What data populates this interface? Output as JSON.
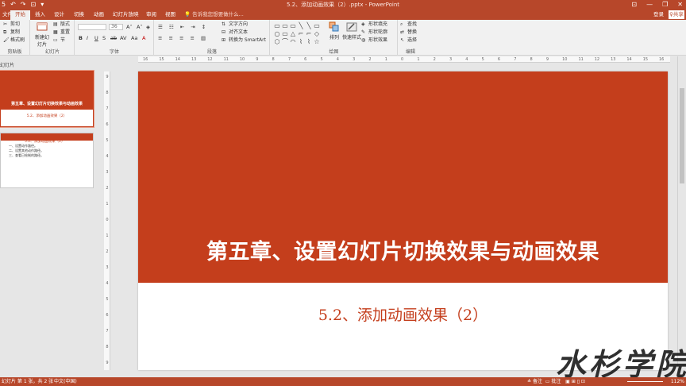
{
  "window": {
    "title": "5.2、添加动画效果（2）.pptx - PowerPoint",
    "qat": [
      "5",
      "↶",
      "↷",
      "⊡",
      "▾"
    ],
    "controls": [
      "⊡",
      "—",
      "❐",
      "✕"
    ]
  },
  "tabs": [
    "文件",
    "开始",
    "插入",
    "设计",
    "切换",
    "动画",
    "幻灯片放映",
    "审阅",
    "视图"
  ],
  "tell_me": "告诉我您想要做什么...",
  "account": {
    "login": "登录",
    "share": "共享"
  },
  "ribbon": {
    "clipboard": {
      "cut": "剪切",
      "copy": "复制",
      "format_painter": "格式刷",
      "label": "剪贴板"
    },
    "slides": {
      "new_slide": "新建幻灯片",
      "layout": "版式",
      "reset": "重置",
      "section": "节",
      "label": "幻灯片"
    },
    "font": {
      "font_size": "36",
      "format_buttons": [
        "B",
        "I",
        "U",
        "S",
        "ab",
        "AV",
        "Aa",
        "A"
      ],
      "label": "字体"
    },
    "paragraph": {
      "text_direction": "文字方向",
      "align_text": "对齐文本",
      "smartart": "转换为 SmartArt",
      "label": "段落"
    },
    "drawing": {
      "arrange": "排列",
      "quick_styles": "快速样式",
      "shape_fill": "形状填充",
      "shape_outline": "形状轮廓",
      "shape_effects": "形状效果",
      "label": "绘图",
      "shape_icons": [
        "▭",
        "▭",
        "▭",
        "╲",
        "╲",
        "▭",
        "○",
        "▭",
        "△",
        "⌐",
        "⌐",
        "◇",
        "⬡",
        "⌒",
        "◠",
        "⌇",
        "⌇",
        "☆"
      ]
    },
    "editing": {
      "find": "查找",
      "replace": "替换",
      "select": "选择",
      "label": "编辑"
    }
  },
  "left_panel": {
    "label": "幻灯片",
    "thumb1": {
      "title": "第五章、设置幻灯片切换效果与动画效果",
      "subtitle": "5.2、添加动画效果（2）"
    },
    "thumb2": {
      "title": "5.2、添加动画效果（2）",
      "lines": [
        "一、设置动作路径。",
        "二、设置其他动作路径。",
        "三、查看已绘制的路径。"
      ]
    }
  },
  "ruler": {
    "horizontal": [
      "16",
      "15",
      "14",
      "13",
      "12",
      "11",
      "10",
      "9",
      "8",
      "7",
      "6",
      "5",
      "4",
      "3",
      "2",
      "1",
      "0",
      "1",
      "2",
      "3",
      "4",
      "5",
      "6",
      "7",
      "8",
      "9",
      "10",
      "11",
      "12",
      "13",
      "14",
      "15",
      "16"
    ],
    "vertical": [
      "9",
      "8",
      "7",
      "6",
      "5",
      "4",
      "3",
      "2",
      "1",
      "0",
      "1",
      "2",
      "3",
      "4",
      "5",
      "6",
      "7",
      "8",
      "9"
    ]
  },
  "slide": {
    "title": "第五章、设置幻灯片切换效果与动画效果",
    "subtitle": "5.2、添加动画效果（2）"
  },
  "watermark": "水杉学院",
  "status": {
    "slide_info": "幻灯片 第 1 张，共 2 张",
    "language": "中文(中国)",
    "notes": "备注",
    "comments": "批注",
    "zoom": "112%"
  }
}
